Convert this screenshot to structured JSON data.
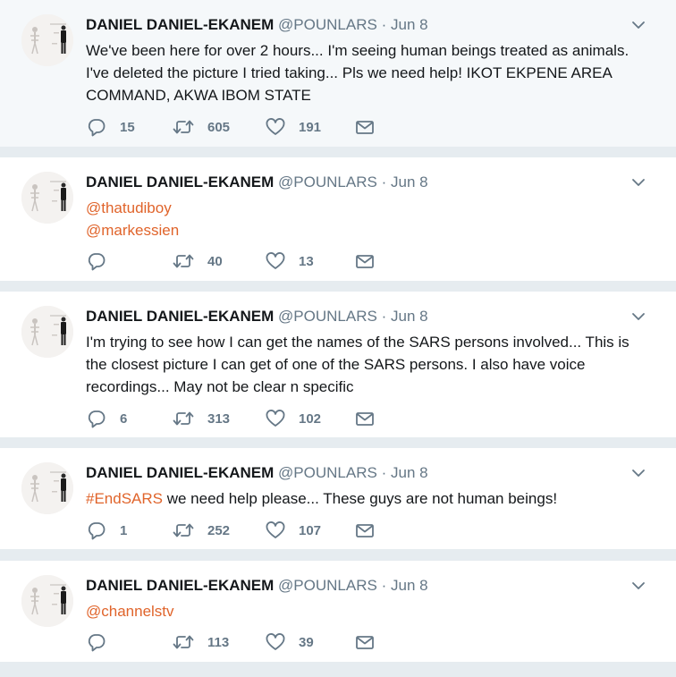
{
  "tweets": [
    {
      "author": "DANIEL DANIEL-EKANEM",
      "handle": "@POUNLARS",
      "separator": "·",
      "time": "Jun 8",
      "text_lines": [
        "We've been here for over 2 hours... I'm seeing human beings treated as animals.",
        "I've deleted the picture I tried taking... Pls we need help! IKOT EKPENE AREA",
        "COMMAND, AKWA IBOM STATE"
      ],
      "replies": "15",
      "retweets": "605",
      "likes": "191"
    },
    {
      "author": "DANIEL DANIEL-EKANEM",
      "handle": "@POUNLARS",
      "separator": "·",
      "time": "Jun 8",
      "mentions": [
        "@thatudiboy",
        "@markessien"
      ],
      "replies": "",
      "retweets": "40",
      "likes": "13"
    },
    {
      "author": "DANIEL DANIEL-EKANEM",
      "handle": "@POUNLARS",
      "separator": "·",
      "time": "Jun 8",
      "text_lines": [
        "I'm trying to see how I can get the names of the SARS persons involved... This is",
        "the closest picture I can get of one of the SARS persons. I also have voice",
        "recordings... May not be clear n specific"
      ],
      "replies": "6",
      "retweets": "313",
      "likes": "102"
    },
    {
      "author": "DANIEL DANIEL-EKANEM",
      "handle": "@POUNLARS",
      "separator": "·",
      "time": "Jun 8",
      "hashtag": "#EndSARS",
      "text_after_hashtag": " we need help please... These guys are not human beings!",
      "replies": "1",
      "retweets": "252",
      "likes": "107"
    },
    {
      "author": "DANIEL DANIEL-EKANEM",
      "handle": "@POUNLARS",
      "separator": "·",
      "time": "Jun 8",
      "mentions": [
        "@channelstv"
      ],
      "replies": "",
      "retweets": "113",
      "likes": "39"
    }
  ],
  "colors": {
    "background": "#e6ecf0",
    "link": "#e0642b",
    "muted": "#657786",
    "text": "#14171a"
  }
}
